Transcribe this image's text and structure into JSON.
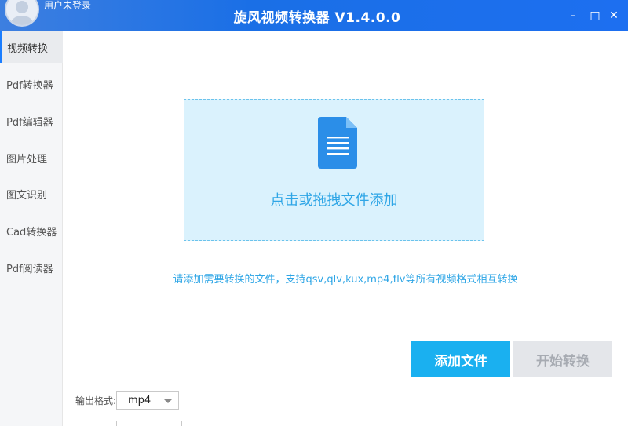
{
  "window": {
    "title": "旋风视频转换器 V1.4.0.0",
    "user_label": "用户未登录",
    "controls": {
      "minimize": "–",
      "maximize": "□",
      "close": "✕"
    }
  },
  "sidebar": {
    "items": [
      {
        "label": "视频转换",
        "active": true
      },
      {
        "label": "Pdf转换器"
      },
      {
        "label": "Pdf编辑器"
      },
      {
        "label": "图片处理"
      },
      {
        "label": "图文识别"
      },
      {
        "label": "Cad转换器"
      },
      {
        "label": "Pdf阅读器"
      }
    ]
  },
  "main": {
    "dropzone_text": "点击或拖拽文件添加",
    "hint": "请添加需要转换的文件，支持qsv,qlv,kux,mp4,flv等所有视频格式相互转换",
    "add_button": "添加文件",
    "start_button": "开始转换",
    "output_format_label": "输出格式:",
    "output_format_value": "mp4"
  },
  "colors": {
    "titlebar": "#1a6fe6",
    "accent": "#1ab0f0",
    "hint_text": "#2fa6e6",
    "dropzone_bg": "#daf2fd",
    "disabled_button": "#e4e6ea"
  },
  "icons": {
    "avatar": "user-avatar-icon",
    "file": "document-icon"
  }
}
